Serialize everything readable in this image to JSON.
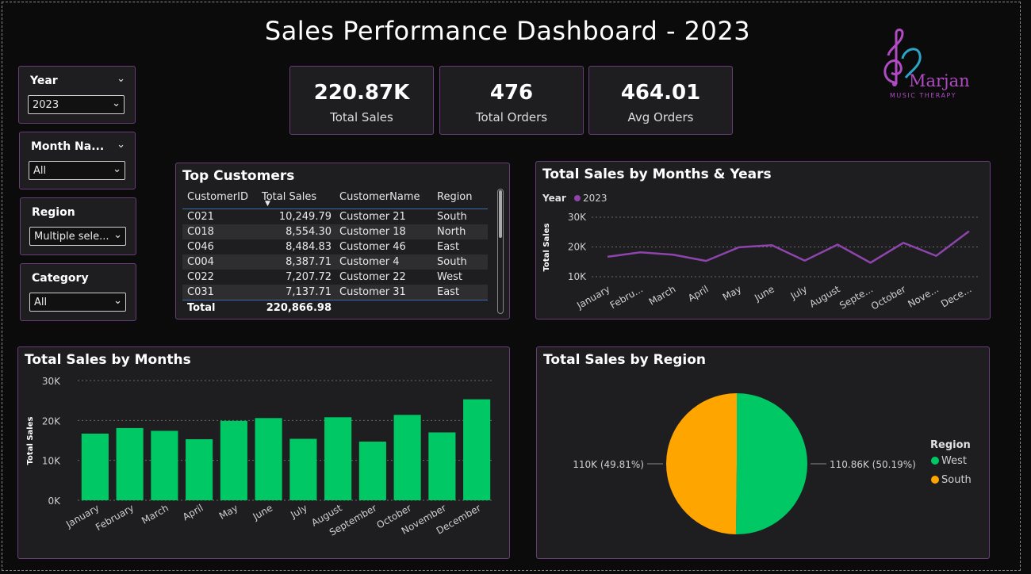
{
  "title": "Sales Performance Dashboard - 2023",
  "logo": {
    "name": "Marjan",
    "tagline": "MUSIC THERAPY",
    "color": "#b14bc4",
    "accent": "#2aa6c7"
  },
  "slicers": [
    {
      "title": "Year",
      "value": "2023"
    },
    {
      "title": "Month Na...",
      "value": "All"
    },
    {
      "title": "Region",
      "value": "Multiple sele..."
    },
    {
      "title": "Category",
      "value": "All"
    }
  ],
  "kpis": [
    {
      "value": "220.87K",
      "label": "Total Sales"
    },
    {
      "value": "476",
      "label": "Total Orders"
    },
    {
      "value": "464.01",
      "label": "Avg Orders"
    }
  ],
  "top_customers": {
    "title": "Top Customers",
    "columns": [
      "CustomerID",
      "Total Sales",
      "CustomerName",
      "Region"
    ],
    "sort_icon": "sort-desc-icon",
    "rows": [
      [
        "C021",
        "10,249.79",
        "Customer 21",
        "South"
      ],
      [
        "C018",
        "8,554.30",
        "Customer 18",
        "North"
      ],
      [
        "C046",
        "8,484.83",
        "Customer 46",
        "East"
      ],
      [
        "C004",
        "8,387.71",
        "Customer 4",
        "South"
      ],
      [
        "C022",
        "7,207.72",
        "Customer 22",
        "West"
      ],
      [
        "C031",
        "7,137.71",
        "Customer 31",
        "East"
      ]
    ],
    "total_label": "Total",
    "total_value": "220,866.98"
  },
  "colors": {
    "accent_green": "#00c864",
    "accent_purple": "#8e44ad",
    "accent_orange": "#ffa500",
    "border": "#6b3c7a"
  },
  "chart_data": [
    {
      "type": "line",
      "title": "Total Sales by Months & Years",
      "legend_title": "Year",
      "xlabel": "",
      "ylabel": "Total Sales",
      "categories": [
        "January",
        "Febru...",
        "March",
        "April",
        "May",
        "June",
        "July",
        "August",
        "Septe...",
        "October",
        "Nove...",
        "Dece..."
      ],
      "series": [
        {
          "name": "2023",
          "values": [
            16700,
            18200,
            17400,
            15300,
            19900,
            20600,
            15400,
            20800,
            14700,
            21400,
            17000,
            25300
          ]
        }
      ],
      "yticks": [
        "10K",
        "20K",
        "30K"
      ],
      "ylim": [
        10000,
        30000
      ],
      "grid": true,
      "legend": "top-left"
    },
    {
      "type": "bar",
      "title": "Total Sales by Months",
      "xlabel": "",
      "ylabel": "Total Sales",
      "categories": [
        "January",
        "February",
        "March",
        "April",
        "May",
        "June",
        "July",
        "August",
        "September",
        "October",
        "November",
        "December"
      ],
      "values": [
        16700,
        18100,
        17400,
        15300,
        19900,
        20600,
        15400,
        20800,
        14700,
        21400,
        17000,
        25300
      ],
      "yticks": [
        "0K",
        "10K",
        "20K",
        "30K"
      ],
      "ylim": [
        0,
        30000
      ],
      "grid": true
    },
    {
      "type": "pie",
      "title": "Total Sales by Region",
      "legend_title": "Region",
      "slices": [
        {
          "name": "West",
          "value": 110860,
          "label": "110.86K (50.19%)",
          "color": "#00c864"
        },
        {
          "name": "South",
          "value": 110000,
          "label": "110K (49.81%)",
          "color": "#ffa500"
        }
      ],
      "legend": "right"
    }
  ]
}
